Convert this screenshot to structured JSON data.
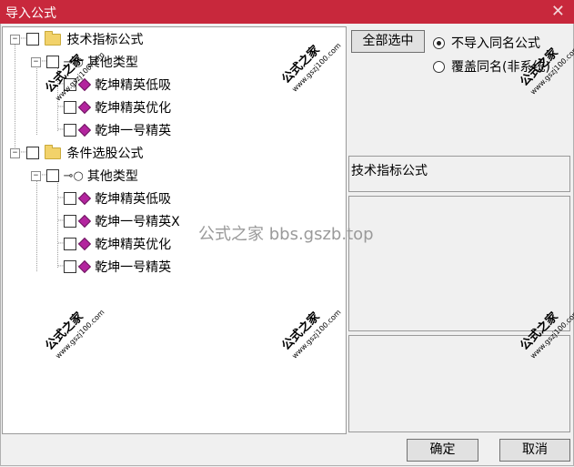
{
  "window": {
    "title": "导入公式",
    "close_glyph": "✕"
  },
  "tree": {
    "groups": [
      {
        "label": "技术指标公式",
        "subgroup": "其他类型",
        "items": [
          "乾坤精英低吸",
          "乾坤精英优化",
          "乾坤一号精英"
        ]
      },
      {
        "label": "条件选股公式",
        "subgroup": "其他类型",
        "items": [
          "乾坤精英低吸",
          "乾坤一号精英X",
          "乾坤精英优化",
          "乾坤一号精英"
        ]
      }
    ],
    "expander_glyph": "−"
  },
  "controls": {
    "select_all_label": "全部选中",
    "radio_options": [
      {
        "label": "不导入同名公式",
        "selected": true
      },
      {
        "label": "覆盖同名(非系统)",
        "selected": false
      }
    ],
    "info_text": "技术指标公式",
    "ok_label": "确定",
    "cancel_label": "取消"
  },
  "watermark": {
    "text": "公式之家",
    "url": "www.gszj100.com",
    "center_text": "公式之家 bbs.gszb.top"
  },
  "colors": {
    "titlebar": "#c8283c",
    "gem": "#b3249e",
    "folder": "#f2d26a"
  },
  "icons": [
    "folder-icon",
    "key-icon",
    "gem-icon",
    "close-icon"
  ]
}
